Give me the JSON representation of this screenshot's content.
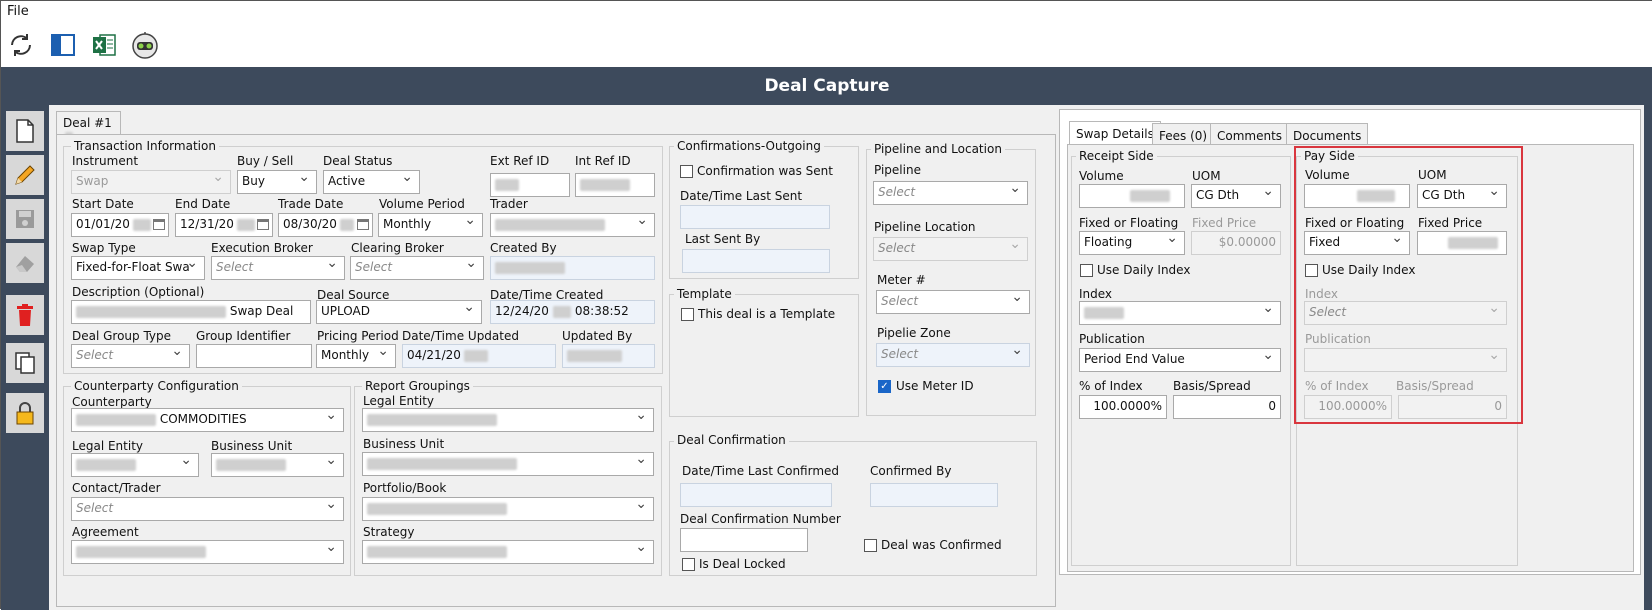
{
  "menu": {
    "file": "File"
  },
  "toolbar": {
    "icons": [
      "refresh-icon",
      "split-pane-icon",
      "excel-icon",
      "robot-icon"
    ]
  },
  "title": "Deal Capture",
  "side_icons": [
    "new-document-icon",
    "edit-pencil-icon",
    "save-disk-icon",
    "eraser-icon",
    "delete-trash-icon",
    "copy-icon",
    "lock-icon"
  ],
  "deal_tab": "Deal #1",
  "ti": {
    "group": "Transaction Information",
    "instrument_l": "Instrument",
    "instrument": "Swap",
    "buysell_l": "Buy / Sell",
    "buysell": "Buy",
    "status_l": "Deal Status",
    "status": "Active",
    "extref_l": "Ext Ref ID",
    "intref_l": "Int Ref ID",
    "start_l": "Start Date",
    "start": "01/01/20",
    "end_l": "End Date",
    "end": "12/31/20",
    "trade_l": "Trade Date",
    "trade": "08/30/20",
    "volper_l": "Volume Period",
    "volper": "Monthly",
    "trader_l": "Trader",
    "swaptype_l": "Swap Type",
    "swaptype": "Fixed-for-Float Swa",
    "execbroker_l": "Execution Broker",
    "execbroker": "Select",
    "clearbroker_l": "Clearing Broker",
    "clearbroker": "Select",
    "createdby_l": "Created By",
    "desc_l": "Description (Optional)",
    "desc": "Swap Deal",
    "source_l": "Deal Source",
    "source": "UPLOAD",
    "created_l": "Date/Time Created",
    "created_date": "12/24/20",
    "created_time": "08:38:52",
    "dgtype_l": "Deal Group Type",
    "dgtype": "Select",
    "groupid_l": "Group Identifier",
    "pricing_l": "Pricing Period",
    "pricing": "Monthly",
    "updated_l": "Date/Time Updated",
    "updated": "04/21/20",
    "updatedby_l": "Updated By"
  },
  "cp": {
    "group": "Counterparty Configuration",
    "counterparty_l": "Counterparty",
    "counterparty": "COMMODITIES",
    "legal_l": "Legal Entity",
    "bu_l": "Business Unit",
    "contact_l": "Contact/Trader",
    "contact": "Select",
    "agreement_l": "Agreement"
  },
  "rg": {
    "group": "Report Groupings",
    "legal_l": "Legal Entity",
    "bu_l": "Business Unit",
    "portfolio_l": "Portfolio/Book",
    "strategy_l": "Strategy"
  },
  "conf": {
    "group": "Confirmations-Outgoing",
    "sent": "Confirmation was Sent",
    "lastsent_l": "Date/Time Last Sent",
    "lastsentby_l": "Last Sent By"
  },
  "template": {
    "group": "Template",
    "is_template": "This deal is a Template"
  },
  "dealconf": {
    "group": "Deal Confirmation",
    "lastconf_l": "Date/Time Last Confirmed",
    "confby_l": "Confirmed By",
    "confnum_l": "Deal Confirmation Number",
    "confirmed": "Deal was Confirmed",
    "locked": "Is Deal Locked"
  },
  "pl": {
    "group": "Pipeline and Location",
    "pipeline_l": "Pipeline",
    "pipeline": "Select",
    "location_l": "Pipeline Location",
    "location": "Select",
    "meter_l": "Meter #",
    "meter": "Select",
    "zone_l": "Pipelie  Zone",
    "zone": "Select",
    "use_meter": "Use Meter ID"
  },
  "tabs": {
    "swap": "Swap Details",
    "fees": "Fees (0)",
    "comments": "Comments",
    "documents": "Documents"
  },
  "receipt": {
    "group": "Receipt Side",
    "volume_l": "Volume",
    "uom_l": "UOM",
    "uom": "CG Dth",
    "ff_l": "Fixed or Floating",
    "ff": "Floating",
    "fp_l": "Fixed Price",
    "fp": "$0.00000",
    "daily": "Use Daily Index",
    "index_l": "Index",
    "pub_l": "Publication",
    "pub": "Period End Value",
    "pct_l": "% of Index",
    "pct": "100.0000%",
    "basis_l": "Basis/Spread",
    "basis": "0"
  },
  "pay": {
    "group": "Pay Side",
    "volume_l": "Volume",
    "uom_l": "UOM",
    "uom": "CG Dth",
    "ff_l": "Fixed or Floating",
    "ff": "Fixed",
    "fp_l": "Fixed Price",
    "daily": "Use Daily Index",
    "index_l": "Index",
    "index": "Select",
    "pub_l": "Publication",
    "pct_l": "% of Index",
    "pct": "100.0000%",
    "basis_l": "Basis/Spread",
    "basis": "0"
  },
  "colors": {
    "titlebar": "#3d4a5c",
    "highlight": "#d9363e",
    "checkbox": "#1a66c8"
  }
}
